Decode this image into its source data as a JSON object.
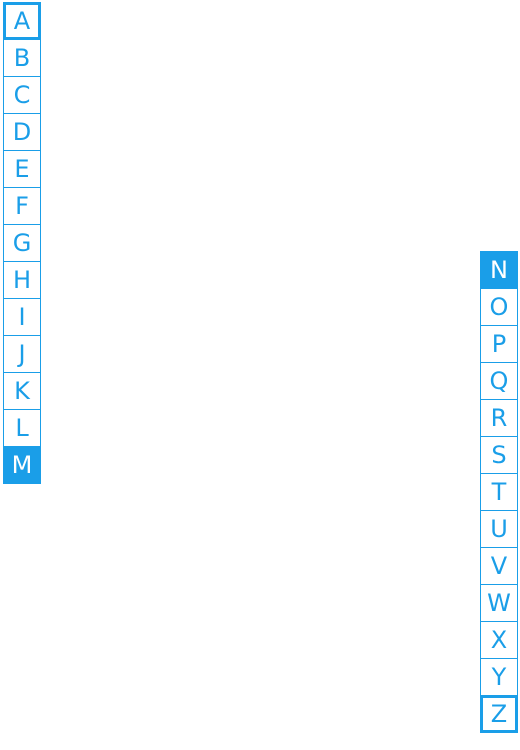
{
  "left_column": {
    "letters": [
      "A",
      "B",
      "C",
      "D",
      "E",
      "F",
      "G",
      "H",
      "I",
      "J",
      "K",
      "L",
      "M"
    ],
    "outlined": [
      "A"
    ],
    "filled": [
      "M"
    ]
  },
  "right_column": {
    "letters": [
      "N",
      "O",
      "P",
      "Q",
      "R",
      "S",
      "T",
      "U",
      "V",
      "W",
      "X",
      "Y",
      "Z"
    ],
    "outlined": [
      "Z"
    ],
    "filled": [
      "N"
    ]
  },
  "colors": {
    "accent": "#1a9ee8",
    "background": "#ffffff"
  }
}
